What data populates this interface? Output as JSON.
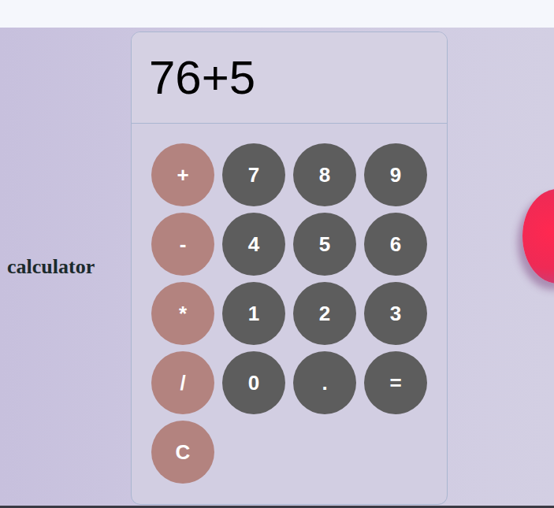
{
  "label": "calculator",
  "display": "76+5",
  "keys": [
    {
      "text": "+",
      "kind": "operator"
    },
    {
      "text": "7",
      "kind": "digit"
    },
    {
      "text": "8",
      "kind": "digit"
    },
    {
      "text": "9",
      "kind": "digit"
    },
    {
      "text": "-",
      "kind": "operator"
    },
    {
      "text": "4",
      "kind": "digit"
    },
    {
      "text": "5",
      "kind": "digit"
    },
    {
      "text": "6",
      "kind": "digit"
    },
    {
      "text": "*",
      "kind": "operator"
    },
    {
      "text": "1",
      "kind": "digit"
    },
    {
      "text": "2",
      "kind": "digit"
    },
    {
      "text": "3",
      "kind": "digit"
    },
    {
      "text": "/",
      "kind": "operator"
    },
    {
      "text": "0",
      "kind": "digit"
    },
    {
      "text": ".",
      "kind": "digit"
    },
    {
      "text": "=",
      "kind": "digit"
    },
    {
      "text": "C",
      "kind": "operator"
    }
  ]
}
